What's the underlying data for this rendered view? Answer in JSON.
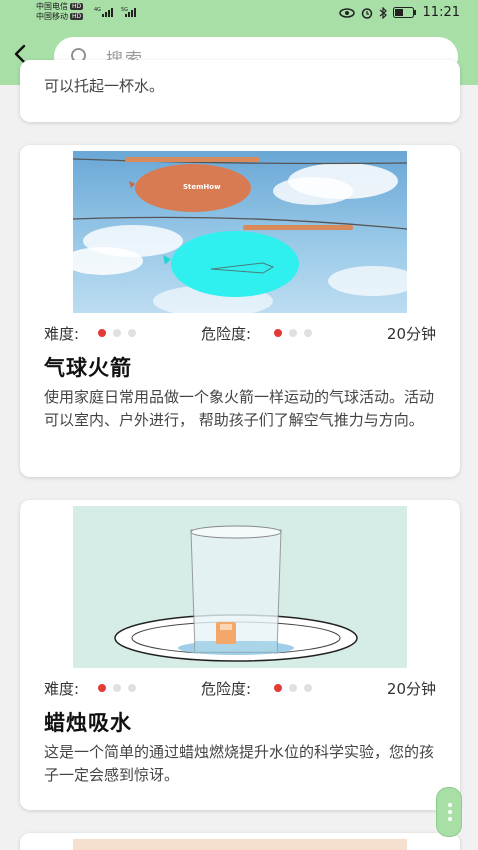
{
  "status_bar": {
    "carrier1": "中国电信",
    "carrier2": "中国移动",
    "hd": "HD",
    "net1": "4G",
    "net2": "5G",
    "time": "11:21"
  },
  "search": {
    "placeholder": "搜索"
  },
  "top_card": {
    "partial_text": "可以托起一杯水。"
  },
  "experiments": [
    {
      "difficulty_label": "难度:",
      "difficulty_level": 1,
      "danger_label": "危险度:",
      "danger_level": 1,
      "duration": "20分钟",
      "title": "气球火箭",
      "description": "使用家庭日常用品做一个象火箭一样运动的气球活动。活动可以室内、户外进行， 帮助孩子们了解空气推力与方向。",
      "image_label": "StemHow"
    },
    {
      "difficulty_label": "难度:",
      "difficulty_level": 1,
      "danger_label": "危险度:",
      "danger_level": 1,
      "duration": "20分钟",
      "title": "蜡烛吸水",
      "description": "这是一个简单的通过蜡烛燃烧提升水位的科学实验，您的孩子一定会感到惊讶。"
    }
  ],
  "colors": {
    "header": "#a8dfa7",
    "dot_active": "#e53935",
    "dot_inactive": "#e0e0e0"
  }
}
